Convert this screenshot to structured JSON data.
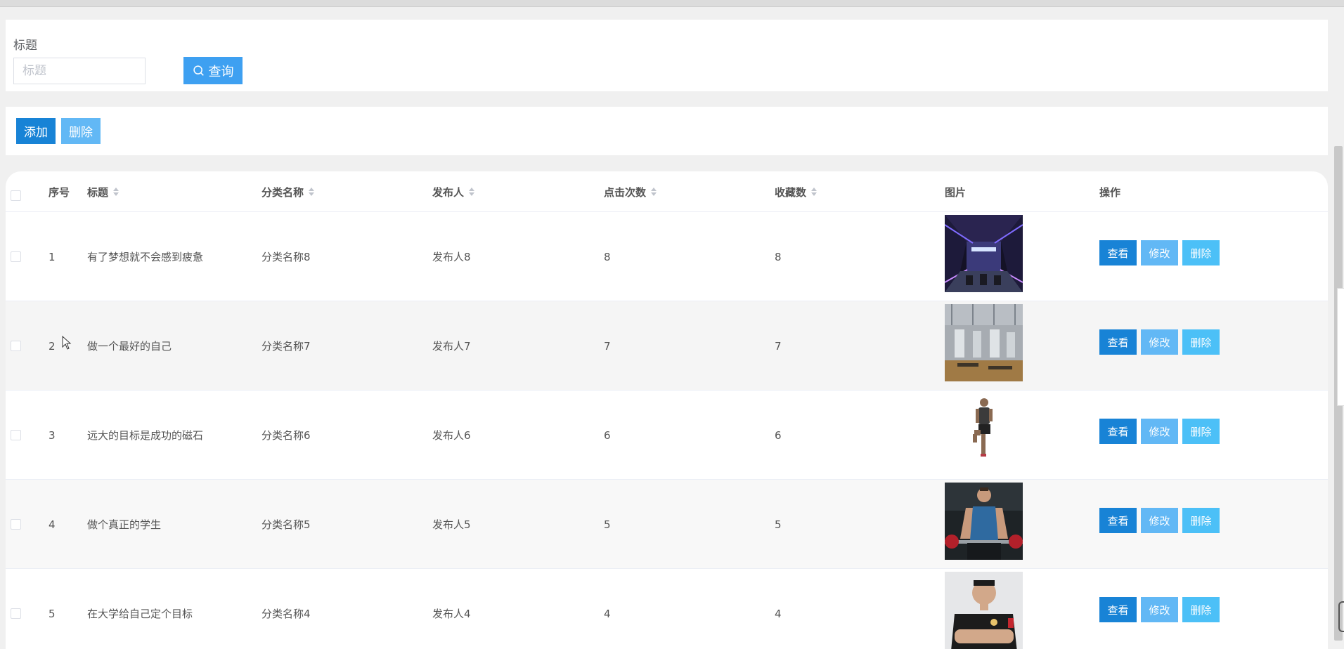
{
  "search": {
    "label": "标题",
    "placeholder": "标题",
    "button_label": "查询"
  },
  "actions": {
    "add_label": "添加",
    "delete_label": "删除"
  },
  "table": {
    "columns": {
      "index": "序号",
      "title": "标题",
      "category": "分类名称",
      "publisher": "发布人",
      "clicks": "点击次数",
      "favorites": "收藏数",
      "image": "图片",
      "ops": "操作"
    },
    "ops_labels": {
      "view": "查看",
      "edit": "修改",
      "delete": "删除"
    },
    "rows": [
      {
        "index": "1",
        "title": "有了梦想就不会感到疲惫",
        "category": "分类名称8",
        "publisher": "发布人8",
        "clicks": "8",
        "favorites": "8"
      },
      {
        "index": "2",
        "title": "做一个最好的自己",
        "category": "分类名称7",
        "publisher": "发布人7",
        "clicks": "7",
        "favorites": "7"
      },
      {
        "index": "3",
        "title": "远大的目标是成功的磁石",
        "category": "分类名称6",
        "publisher": "发布人6",
        "clicks": "6",
        "favorites": "6"
      },
      {
        "index": "4",
        "title": "做个真正的学生",
        "category": "分类名称5",
        "publisher": "发布人5",
        "clicks": "5",
        "favorites": "5"
      },
      {
        "index": "5",
        "title": "在大学给自己定个目标",
        "category": "分类名称4",
        "publisher": "发布人4",
        "clicks": "4",
        "favorites": "4"
      }
    ]
  },
  "colors": {
    "primary": "#1883d6",
    "light": "#62b8f5",
    "query": "#3ea0f1"
  }
}
